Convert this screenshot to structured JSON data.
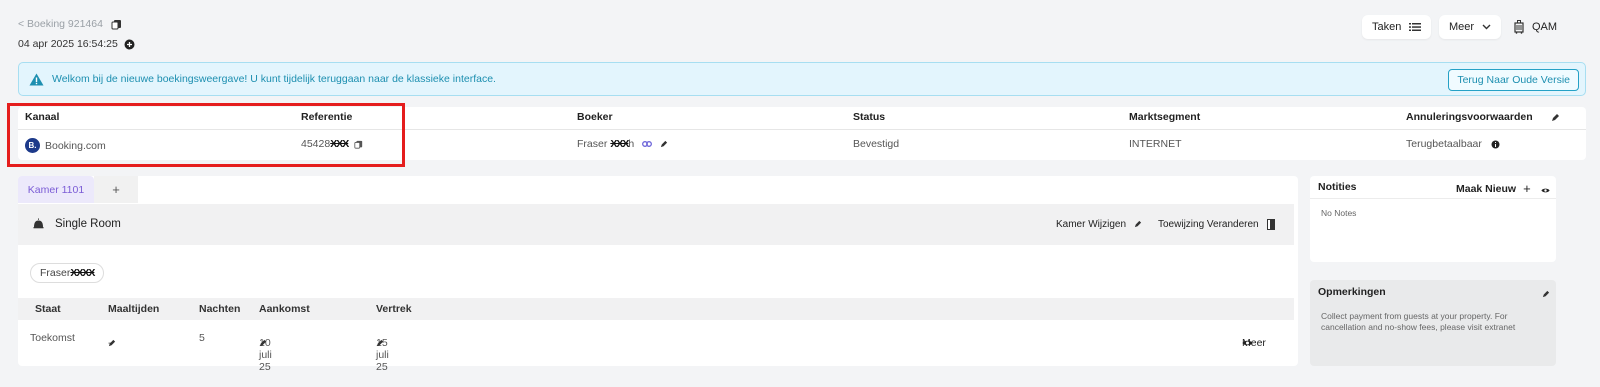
{
  "header": {
    "back_label": "< Boeking 921464",
    "date": "04 apr 2025 16:54:25",
    "tasks_label": "Taken",
    "more_label": "Meer",
    "user_label": "QAM"
  },
  "banner": {
    "text": "Welkom bij de nieuwe boekingsweergave! U kunt tijdelijk teruggaan naar de klassieke interface.",
    "button_label": "Terug Naar Oude Versie"
  },
  "info": {
    "channel_head": "Kanaal",
    "channel_badge": "B.",
    "channel_val": "Booking.com",
    "ref_head": "Referentie",
    "ref_val": "45428",
    "ref_redacted": "XXX",
    "booker_head": "Boeker",
    "booker_val": "Fraser",
    "booker_redacted": "XXX",
    "booker_tail": "h",
    "status_head": "Status",
    "status_val": "Bevestigd",
    "segment_head": "Marktsegment",
    "segment_val": "INTERNET",
    "cancel_head": "Annuleringsvoorwaarden",
    "cancel_val": "Terugbetaalbaar"
  },
  "room": {
    "tab_label": "Kamer 1101",
    "tab_add": "+",
    "room_name": "Single Room",
    "change_room": "Kamer Wijzigen",
    "change_assign": "Toewijzing Veranderen",
    "guest_name": "Fraser",
    "guest_redacted": "XXXX",
    "cols": [
      "Staat",
      "Maaltijden",
      "Nachten",
      "Aankomst",
      "Vertrek"
    ],
    "row": {
      "state": "Toekomst",
      "meals": "-",
      "nights": "5",
      "arrival": "10 juli 25",
      "departure": "15 juli 25",
      "more": "Meer"
    }
  },
  "notes": {
    "title": "Notities",
    "add_label": "Maak Nieuw",
    "empty": "No Notes"
  },
  "remarks": {
    "title": "Opmerkingen",
    "text": "Collect payment from guests at your property. For cancellation and no-show fees, please visit extranet"
  },
  "colors": {
    "accent_purple": "#7b5cd6",
    "banner_bg": "#e3f5fd",
    "banner_text": "#1d8fb0",
    "highlight_red": "#e51d1d",
    "booking_blue": "#1d3a8a"
  },
  "icons": [
    "copy-icon",
    "plus-circle-icon",
    "list-icon",
    "chevron-down-icon",
    "luggage-icon",
    "warning-icon",
    "pencil-icon",
    "link-icon",
    "info-icon",
    "bell-icon",
    "door-icon",
    "eye-icon",
    "plus-icon"
  ]
}
